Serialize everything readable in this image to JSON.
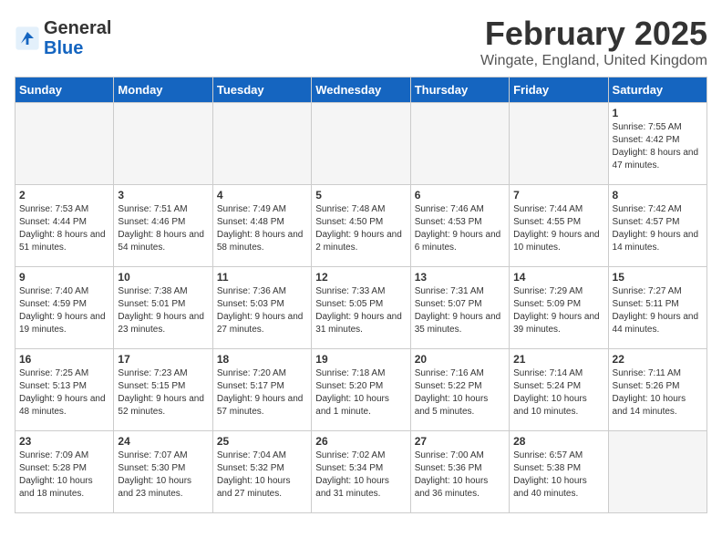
{
  "header": {
    "logo_line1": "General",
    "logo_line2": "Blue",
    "month": "February 2025",
    "location": "Wingate, England, United Kingdom"
  },
  "days_of_week": [
    "Sunday",
    "Monday",
    "Tuesday",
    "Wednesday",
    "Thursday",
    "Friday",
    "Saturday"
  ],
  "weeks": [
    [
      {
        "day": "",
        "info": ""
      },
      {
        "day": "",
        "info": ""
      },
      {
        "day": "",
        "info": ""
      },
      {
        "day": "",
        "info": ""
      },
      {
        "day": "",
        "info": ""
      },
      {
        "day": "",
        "info": ""
      },
      {
        "day": "1",
        "info": "Sunrise: 7:55 AM\nSunset: 4:42 PM\nDaylight: 8 hours and 47 minutes."
      }
    ],
    [
      {
        "day": "2",
        "info": "Sunrise: 7:53 AM\nSunset: 4:44 PM\nDaylight: 8 hours and 51 minutes."
      },
      {
        "day": "3",
        "info": "Sunrise: 7:51 AM\nSunset: 4:46 PM\nDaylight: 8 hours and 54 minutes."
      },
      {
        "day": "4",
        "info": "Sunrise: 7:49 AM\nSunset: 4:48 PM\nDaylight: 8 hours and 58 minutes."
      },
      {
        "day": "5",
        "info": "Sunrise: 7:48 AM\nSunset: 4:50 PM\nDaylight: 9 hours and 2 minutes."
      },
      {
        "day": "6",
        "info": "Sunrise: 7:46 AM\nSunset: 4:53 PM\nDaylight: 9 hours and 6 minutes."
      },
      {
        "day": "7",
        "info": "Sunrise: 7:44 AM\nSunset: 4:55 PM\nDaylight: 9 hours and 10 minutes."
      },
      {
        "day": "8",
        "info": "Sunrise: 7:42 AM\nSunset: 4:57 PM\nDaylight: 9 hours and 14 minutes."
      }
    ],
    [
      {
        "day": "9",
        "info": "Sunrise: 7:40 AM\nSunset: 4:59 PM\nDaylight: 9 hours and 19 minutes."
      },
      {
        "day": "10",
        "info": "Sunrise: 7:38 AM\nSunset: 5:01 PM\nDaylight: 9 hours and 23 minutes."
      },
      {
        "day": "11",
        "info": "Sunrise: 7:36 AM\nSunset: 5:03 PM\nDaylight: 9 hours and 27 minutes."
      },
      {
        "day": "12",
        "info": "Sunrise: 7:33 AM\nSunset: 5:05 PM\nDaylight: 9 hours and 31 minutes."
      },
      {
        "day": "13",
        "info": "Sunrise: 7:31 AM\nSunset: 5:07 PM\nDaylight: 9 hours and 35 minutes."
      },
      {
        "day": "14",
        "info": "Sunrise: 7:29 AM\nSunset: 5:09 PM\nDaylight: 9 hours and 39 minutes."
      },
      {
        "day": "15",
        "info": "Sunrise: 7:27 AM\nSunset: 5:11 PM\nDaylight: 9 hours and 44 minutes."
      }
    ],
    [
      {
        "day": "16",
        "info": "Sunrise: 7:25 AM\nSunset: 5:13 PM\nDaylight: 9 hours and 48 minutes."
      },
      {
        "day": "17",
        "info": "Sunrise: 7:23 AM\nSunset: 5:15 PM\nDaylight: 9 hours and 52 minutes."
      },
      {
        "day": "18",
        "info": "Sunrise: 7:20 AM\nSunset: 5:17 PM\nDaylight: 9 hours and 57 minutes."
      },
      {
        "day": "19",
        "info": "Sunrise: 7:18 AM\nSunset: 5:20 PM\nDaylight: 10 hours and 1 minute."
      },
      {
        "day": "20",
        "info": "Sunrise: 7:16 AM\nSunset: 5:22 PM\nDaylight: 10 hours and 5 minutes."
      },
      {
        "day": "21",
        "info": "Sunrise: 7:14 AM\nSunset: 5:24 PM\nDaylight: 10 hours and 10 minutes."
      },
      {
        "day": "22",
        "info": "Sunrise: 7:11 AM\nSunset: 5:26 PM\nDaylight: 10 hours and 14 minutes."
      }
    ],
    [
      {
        "day": "23",
        "info": "Sunrise: 7:09 AM\nSunset: 5:28 PM\nDaylight: 10 hours and 18 minutes."
      },
      {
        "day": "24",
        "info": "Sunrise: 7:07 AM\nSunset: 5:30 PM\nDaylight: 10 hours and 23 minutes."
      },
      {
        "day": "25",
        "info": "Sunrise: 7:04 AM\nSunset: 5:32 PM\nDaylight: 10 hours and 27 minutes."
      },
      {
        "day": "26",
        "info": "Sunrise: 7:02 AM\nSunset: 5:34 PM\nDaylight: 10 hours and 31 minutes."
      },
      {
        "day": "27",
        "info": "Sunrise: 7:00 AM\nSunset: 5:36 PM\nDaylight: 10 hours and 36 minutes."
      },
      {
        "day": "28",
        "info": "Sunrise: 6:57 AM\nSunset: 5:38 PM\nDaylight: 10 hours and 40 minutes."
      },
      {
        "day": "",
        "info": ""
      }
    ]
  ]
}
